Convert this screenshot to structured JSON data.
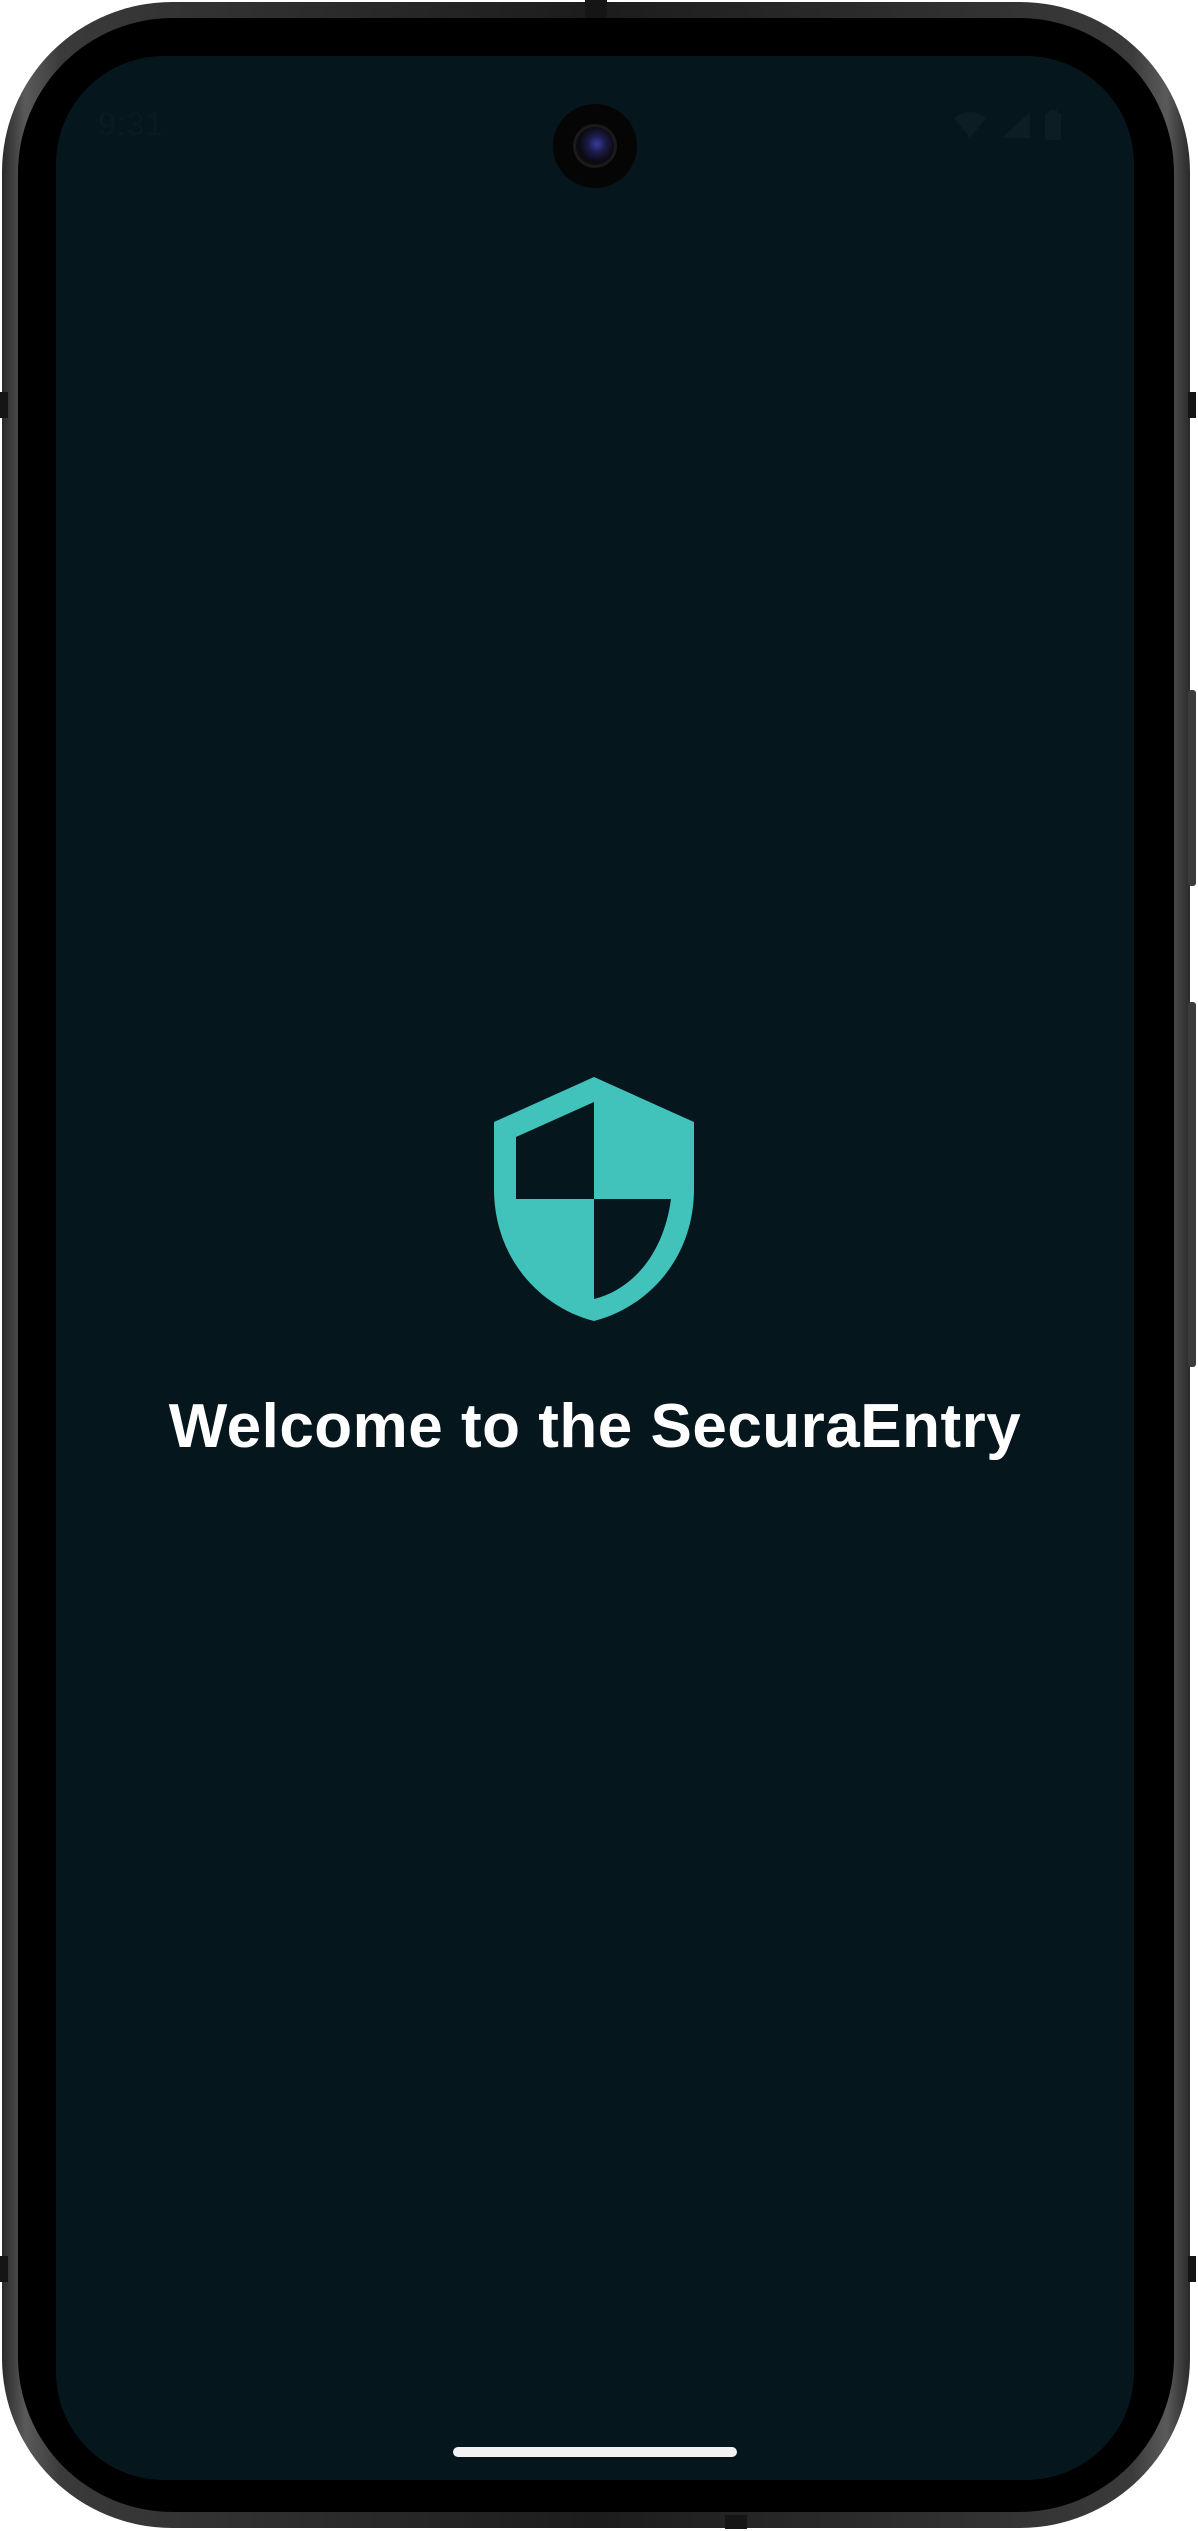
{
  "status_bar": {
    "time": "9:31",
    "icons": [
      "wifi-icon",
      "signal-icon",
      "battery-icon"
    ]
  },
  "welcome": {
    "icon": "shield-icon",
    "title": "Welcome to the SecuraEntry"
  },
  "colors": {
    "background": "#06161d",
    "accent": "#41c3bc",
    "text": "#ffffff"
  }
}
